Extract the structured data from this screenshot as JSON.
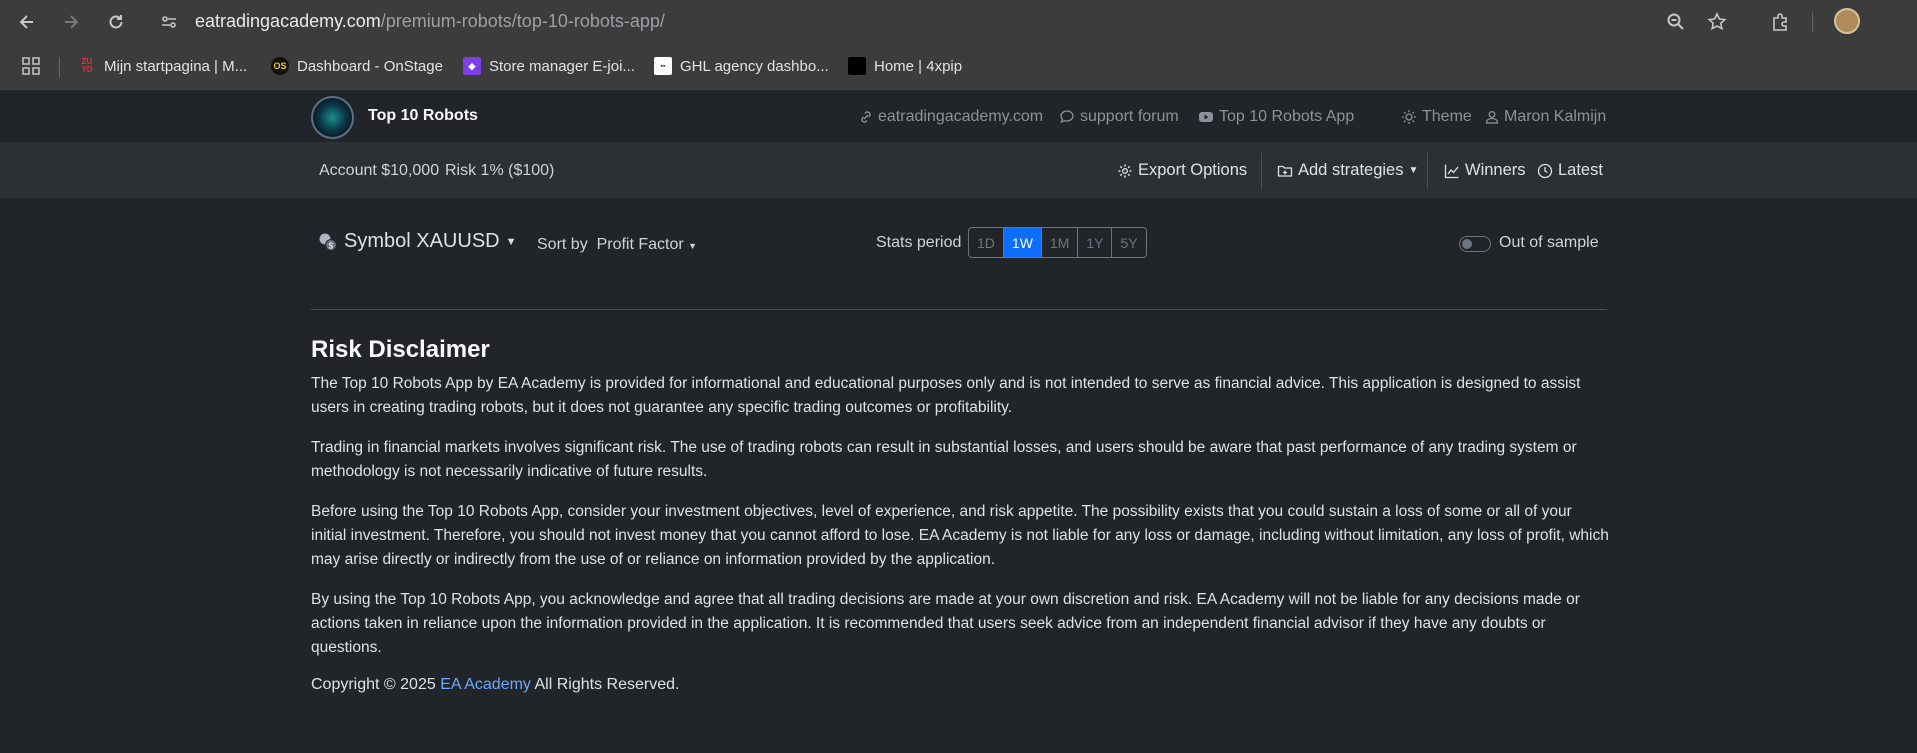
{
  "browser": {
    "url_host": "eatradingacademy.com",
    "url_path": "/premium-robots/top-10-robots-app/",
    "bookmarks": [
      {
        "label": "Mijn startpagina | M..."
      },
      {
        "label": "Dashboard - OnStage"
      },
      {
        "label": "Store manager E-joi..."
      },
      {
        "label": "GHL agency dashbo..."
      },
      {
        "label": "Home | 4xpip"
      }
    ]
  },
  "header": {
    "brand": "Top 10 Robots",
    "links": [
      {
        "label": "eatradingacademy.com"
      },
      {
        "label": "support forum"
      },
      {
        "label": "Top 10 Robots App"
      },
      {
        "label": "Theme"
      },
      {
        "label": "Maron Kalmijn"
      }
    ]
  },
  "toolbar": {
    "account": "Account $10,000",
    "risk": "Risk 1% ($100)",
    "export": "Export Options",
    "add_strategies": "Add strategies",
    "winners": "Winners",
    "latest": "Latest"
  },
  "controls": {
    "symbol": "Symbol XAUUSD",
    "sort_by_label": "Sort by",
    "sort_by_value": "Profit Factor",
    "stats_period_label": "Stats period",
    "periods": [
      "1D",
      "1W",
      "1M",
      "1Y",
      "5Y"
    ],
    "active_period": "1W",
    "out_of_sample_label": "Out of sample",
    "out_of_sample_on": false
  },
  "disclaimer": {
    "title": "Risk Disclaimer",
    "paragraphs": [
      "The Top 10 Robots App by EA Academy is provided for informational and educational purposes only and is not intended to serve as financial advice. This application is designed to assist users in creating trading robots, but it does not guarantee any specific trading outcomes or profitability.",
      "Trading in financial markets involves significant risk. The use of trading robots can result in substantial losses, and users should be aware that past performance of any trading system or methodology is not necessarily indicative of future results.",
      "Before using the Top 10 Robots App, consider your investment objectives, level of experience, and risk appetite. The possibility exists that you could sustain a loss of some or all of your initial investment. Therefore, you should not invest money that you cannot afford to lose. EA Academy is not liable for any loss or damage, including without limitation, any loss of profit, which may arise directly or indirectly from the use of or reliance on information provided by the application.",
      "By using the Top 10 Robots App, you acknowledge and agree that all trading decisions are made at your own discretion and risk. EA Academy will not be liable for any decisions made or actions taken in reliance upon the information provided in the application. It is recommended that users seek advice from an independent financial advisor if they have any doubts or questions."
    ],
    "copyright_prefix": "Copyright © 2025",
    "copyright_link": "EA Academy",
    "copyright_suffix": "All Rights Reserved."
  },
  "colors": {
    "accent": "#0d6efd",
    "link": "#6ea8fe",
    "background": "#212529"
  }
}
